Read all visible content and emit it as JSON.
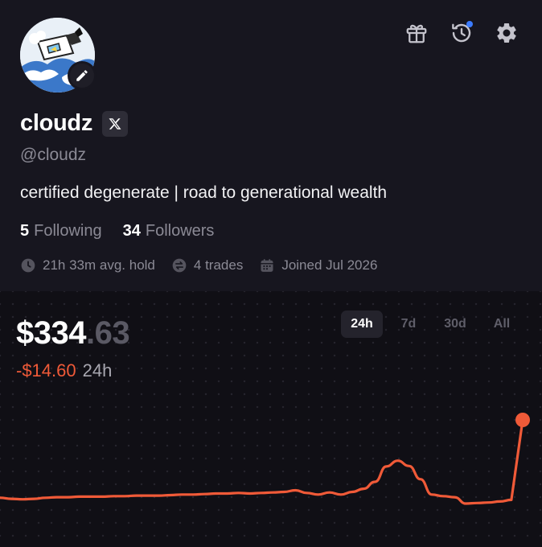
{
  "profile": {
    "name": "cloudz",
    "handle": "@cloudz",
    "bio": "certified degenerate | road to generational wealth",
    "following_count": "5",
    "following_label": "Following",
    "followers_count": "34",
    "followers_label": "Followers",
    "meta": {
      "avg_hold": "21h 33m avg. hold",
      "trades": "4 trades",
      "joined": "Joined Jul 2026"
    }
  },
  "header_icons": [
    "gift-icon",
    "history-icon",
    "gear-icon"
  ],
  "portfolio": {
    "balance_main": "$334",
    "balance_cents": ".63",
    "change_amount": "-$14.60",
    "change_period": "24h",
    "range_tabs": [
      "24h",
      "7d",
      "30d",
      "All"
    ],
    "active_range": "24h"
  },
  "colors": {
    "background": "#17161f",
    "chart_background": "#100f15",
    "accent_negative": "#f05a38",
    "notification_dot": "#3b7bff",
    "muted_text": "#8b8a95"
  },
  "chart_data": {
    "type": "line",
    "series": [
      {
        "values": [
          319.9,
          319.7,
          319.6,
          319.7,
          319.9,
          320.0,
          320.0,
          320.1,
          320.1,
          320.1,
          320.2,
          320.2,
          320.3,
          320.3,
          320.3,
          320.4,
          320.5,
          320.5,
          320.6,
          320.7,
          320.7,
          320.8,
          320.7,
          320.8,
          320.9,
          321.0,
          321.3,
          320.8,
          320.5,
          320.9,
          320.5,
          321.0,
          321.6,
          322.9,
          325.8,
          326.9,
          325.9,
          323.4,
          320.5,
          320.2,
          320.0,
          318.8,
          318.9,
          319.0,
          319.2,
          319.5,
          334.6
        ]
      }
    ],
    "grid": false,
    "legend": "none",
    "line_color": "#f05a38"
  }
}
